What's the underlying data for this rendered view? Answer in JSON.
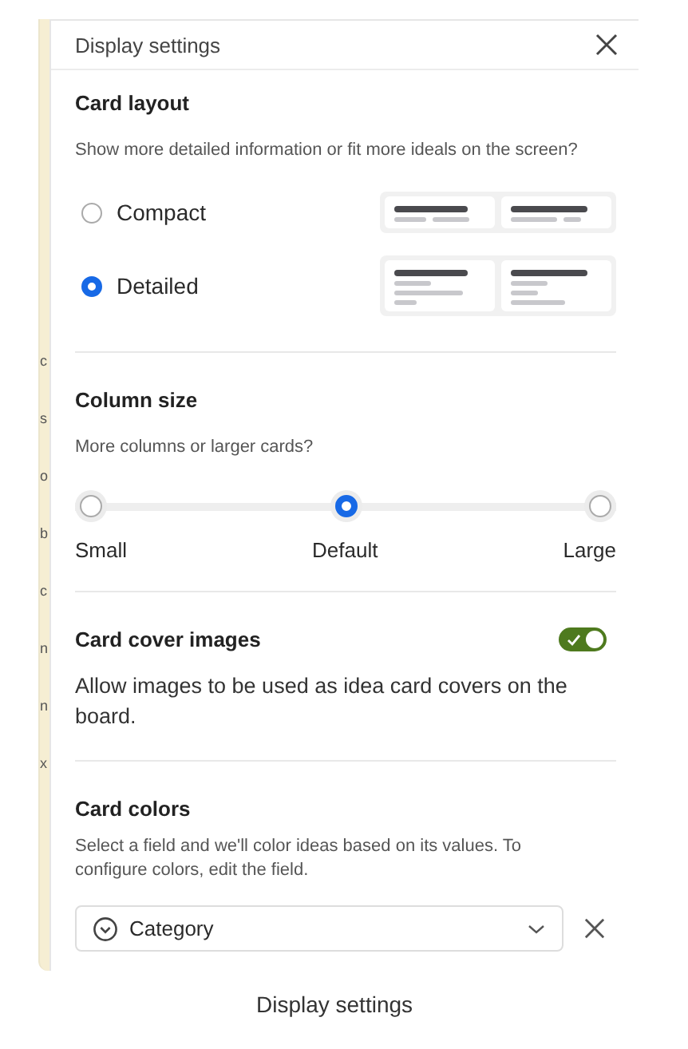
{
  "background_fragments": [
    "c",
    "s",
    "o",
    "b",
    "c",
    "n",
    "n",
    "x"
  ],
  "panel": {
    "title": "Display settings"
  },
  "card_layout": {
    "heading": "Card layout",
    "description": "Show more detailed information or fit more ideals on the screen?",
    "options": [
      {
        "label": "Compact",
        "selected": false,
        "kind": "compact"
      },
      {
        "label": "Detailed",
        "selected": true,
        "kind": "detailed"
      }
    ]
  },
  "column_size": {
    "heading": "Column size",
    "description": "More columns or larger cards?",
    "stops": [
      {
        "label": "Small",
        "selected": false
      },
      {
        "label": "Default",
        "selected": true
      },
      {
        "label": "Large",
        "selected": false
      }
    ]
  },
  "card_cover_images": {
    "heading": "Card cover images",
    "on": true,
    "description": "Allow images to be used as idea card covers on the board."
  },
  "card_colors": {
    "heading": "Card colors",
    "description": "Select a field and we'll color ideas based on its values. To configure colors, edit the field.",
    "field_value": "Category"
  },
  "caption": "Display settings"
}
